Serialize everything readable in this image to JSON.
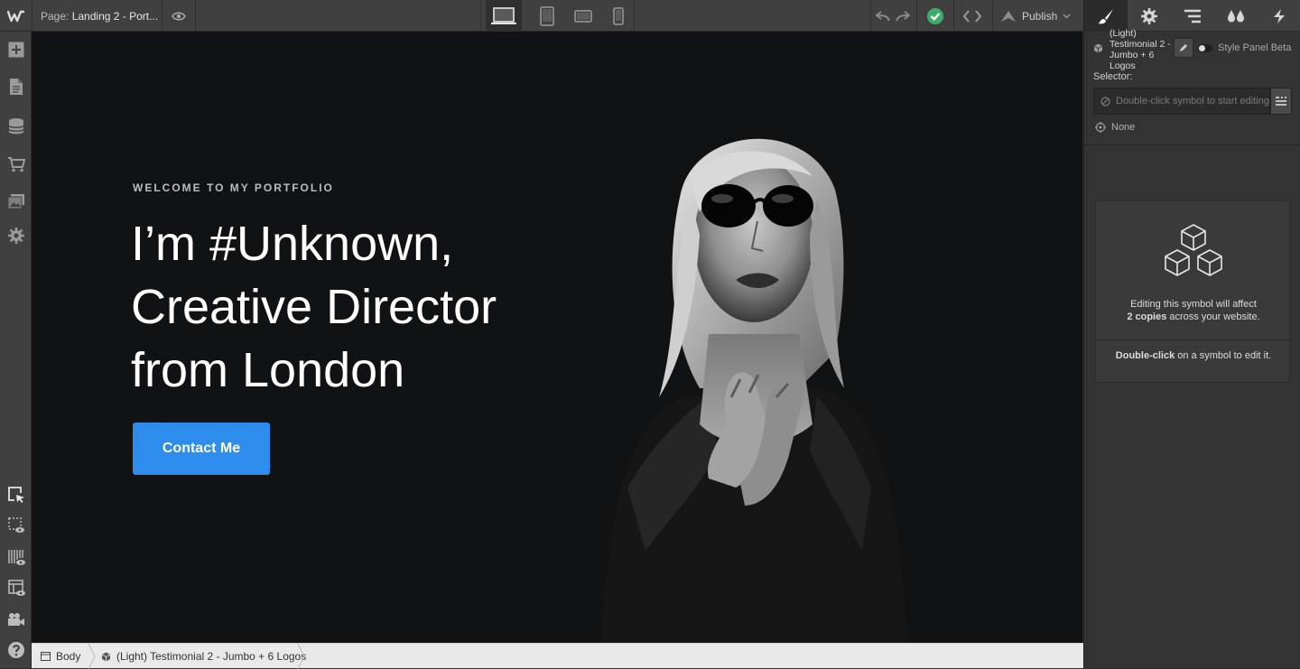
{
  "topbar": {
    "page_prefix": "Page:",
    "page_name": "Landing 2 - Port...",
    "publish_label": "Publish",
    "devices": [
      "desktop",
      "tablet",
      "mobile-landscape",
      "mobile-portrait"
    ],
    "active_device": "desktop",
    "status_color": "#3dae6a"
  },
  "leftbar": {
    "items": [
      "add-icon",
      "pages-icon",
      "cms-icon",
      "ecommerce-icon",
      "assets-icon",
      "settings-icon"
    ],
    "bottom_items": [
      "select-element-icon",
      "preview-element-icon",
      "grid-overlay-icon",
      "layout-preview-icon",
      "video-tutorials-icon",
      "help-icon"
    ]
  },
  "canvas": {
    "eyebrow": "WELCOME TO MY PORTFOLIO",
    "title_line1": "I’m #Unknown,",
    "title_line2": "Creative Director",
    "title_line3": "from London",
    "cta_label": "Contact Me",
    "cta_color": "#2d8cec"
  },
  "breadcrumbs": {
    "items": [
      "Body",
      "(Light) Testimonial 2 - Jumbo + 6 Logos"
    ]
  },
  "rightpanel": {
    "tabs": [
      "style-brush-icon",
      "element-settings-icon",
      "navigator-icon",
      "style-manager-icon",
      "interactions-icon"
    ],
    "symbol_name": "(Light) Testimonial 2 - Jumbo + 6 Logos",
    "style_panel_label": "Style Panel Beta",
    "selector_label": "Selector:",
    "selector_placeholder": "Double-click symbol to start editing",
    "none_label": "None",
    "card_line1": "Editing this symbol will affect",
    "card_line2_bold": "2 copies",
    "card_line2_rest": " across your website.",
    "card_hint_bold": "Double-click",
    "card_hint_rest": " on a symbol to edit it."
  }
}
